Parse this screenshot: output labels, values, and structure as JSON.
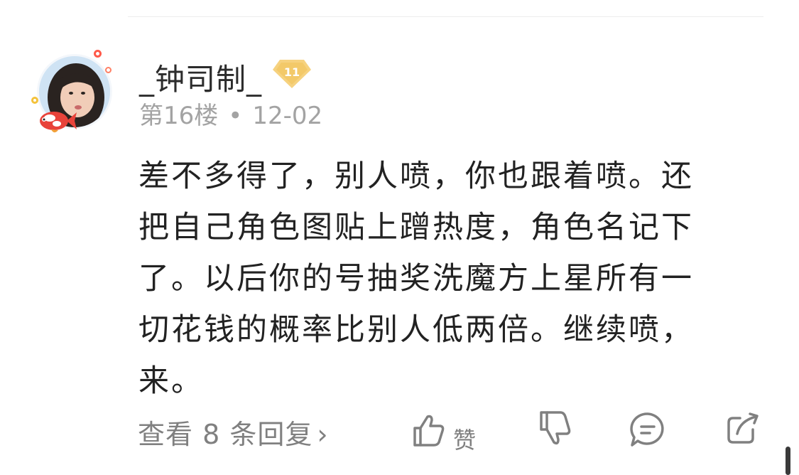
{
  "comment": {
    "username": "_钟司制_",
    "level": "11",
    "floor": "第16楼",
    "separator": "•",
    "date": "12-02",
    "content_lines": [
      "差不多得了，别人喷，你也跟着喷。还",
      "把自己角色图贴上蹭热度，角色名记下",
      "了。以后你的号抽奖洗魔方上星所有一",
      "切花钱的概率比别人低两倍。继续喷，",
      "来。"
    ],
    "replies_label": "查看 8 条回复",
    "replies_chevron": "›",
    "like_label": "赞"
  },
  "colors": {
    "text_primary": "#222222",
    "text_secondary": "#a3a3a3",
    "badge_gold": "#f3c969",
    "icon_gray": "#808080"
  },
  "icons": [
    "avatar",
    "koi-icon",
    "level-badge-icon",
    "thumb-up-icon",
    "thumb-down-icon",
    "comment-icon",
    "share-icon"
  ]
}
